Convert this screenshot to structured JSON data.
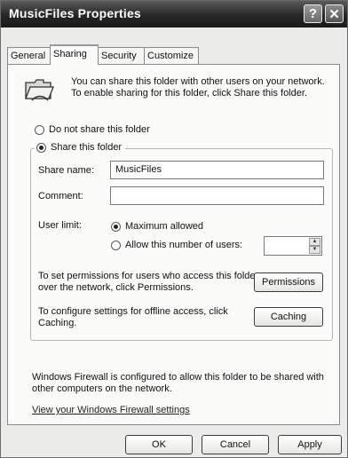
{
  "window": {
    "title": "MusicFiles Properties",
    "help_glyph": "?",
    "close_glyph": "✕"
  },
  "tabs": [
    "General",
    "Sharing",
    "Security",
    "Customize"
  ],
  "active_tab": "Sharing",
  "intro_text": "You can share this folder with other users on your network.  To enable sharing for this folder, click Share this folder.",
  "radios": {
    "no_share": {
      "label": "Do not share this folder",
      "selected": false
    },
    "share": {
      "label": "Share this folder",
      "selected": true
    }
  },
  "share_name": {
    "label": "Share name:",
    "value": "MusicFiles"
  },
  "comment": {
    "label": "Comment:",
    "value": ""
  },
  "user_limit": {
    "label": "User limit:",
    "max_label": "Maximum allowed",
    "max_selected": true,
    "allow_label": "Allow this number of users:",
    "allow_selected": false,
    "count_value": ""
  },
  "permissions": {
    "text": "To set permissions for users who access this folder over the network, click Permissions.",
    "button": "Permissions"
  },
  "caching": {
    "text": "To configure settings for offline access, click Caching.",
    "button": "Caching"
  },
  "firewall_text": "Windows Firewall is configured to allow this folder to be shared with other computers on the network.",
  "firewall_link": "View your Windows Firewall settings",
  "footer": {
    "ok": "OK",
    "cancel": "Cancel",
    "apply": "Apply"
  }
}
